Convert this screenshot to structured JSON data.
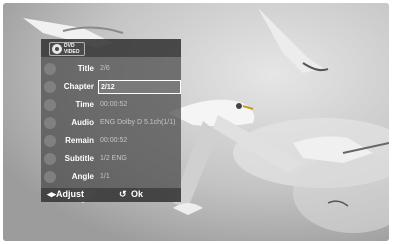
{
  "osd": {
    "logo": {
      "text": "DVD VIDEO"
    },
    "rows": [
      {
        "label": "Title",
        "value": "2/6",
        "icon": "title-icon"
      },
      {
        "label": "Chapter",
        "value": "2/12",
        "icon": "chapter-icon",
        "selected": true
      },
      {
        "label": "Time",
        "value": "00:00:52",
        "icon": "clock-icon"
      },
      {
        "label": "Audio",
        "value": "ENG Dolby D 5.1ch(1/1)",
        "icon": "speaker-icon"
      },
      {
        "label": "Remain",
        "value": "00:00:52",
        "icon": "remain-icon"
      },
      {
        "label": "Subtitle",
        "value": "1/2 ENG",
        "icon": "subtitle-icon"
      },
      {
        "label": "Angle",
        "value": "1/1",
        "icon": "camera-icon"
      }
    ],
    "footer": {
      "adjust": "◂▸Adjust",
      "ok": "Ok",
      "ok_icon": "enter-icon"
    }
  }
}
